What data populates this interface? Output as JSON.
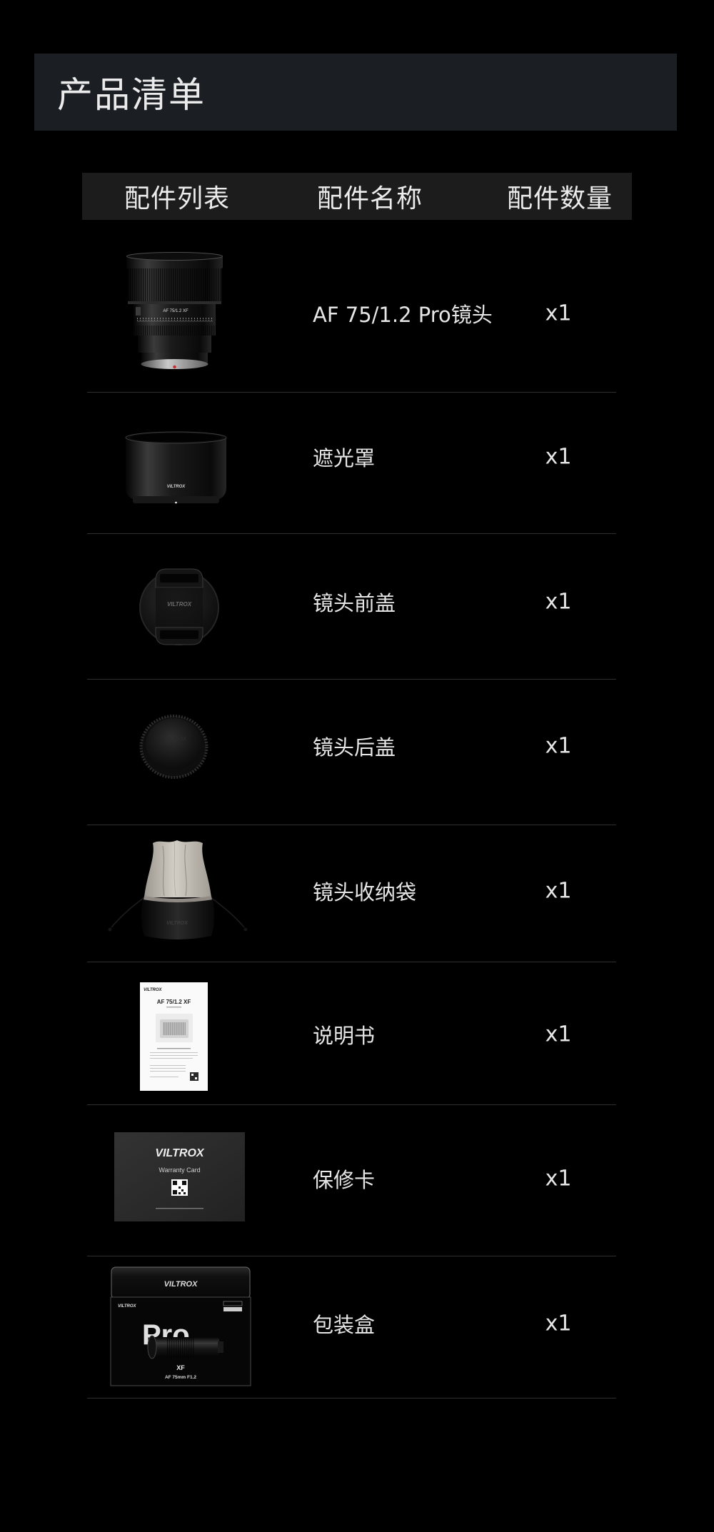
{
  "page": {
    "title": "产品清单"
  },
  "table": {
    "headers": {
      "image": "配件列表",
      "name": "配件名称",
      "quantity": "配件数量"
    },
    "rows": [
      {
        "icon": "lens-icon",
        "name": "AF 75/1.2 Pro镜头",
        "quantity": "x1"
      },
      {
        "icon": "lens-hood-icon",
        "name": "遮光罩",
        "quantity": "x1"
      },
      {
        "icon": "front-lens-cap-icon",
        "name": "镜头前盖",
        "quantity": "x1"
      },
      {
        "icon": "rear-lens-cap-icon",
        "name": "镜头后盖",
        "quantity": "x1"
      },
      {
        "icon": "lens-pouch-icon",
        "name": "镜头收纳袋",
        "quantity": "x1"
      },
      {
        "icon": "manual-icon",
        "name": "说明书",
        "quantity": "x1"
      },
      {
        "icon": "warranty-card-icon",
        "name": "保修卡",
        "quantity": "x1"
      },
      {
        "icon": "packaging-box-icon",
        "name": "包装盒",
        "quantity": "x1"
      }
    ]
  },
  "product_image_text": {
    "brand": "VILTROX",
    "lens_label": "AF 75/1.2 XF",
    "warranty_title": "Warranty Card",
    "box_series": "Pro",
    "box_mount": "XF",
    "box_model": "AF 75mm F1.2"
  },
  "colors": {
    "background": "#000000",
    "title_bar": "#1b1e23",
    "table_header": "#1c1c1c",
    "divider": "#2f2f2f",
    "text": "#e6e6e6"
  }
}
